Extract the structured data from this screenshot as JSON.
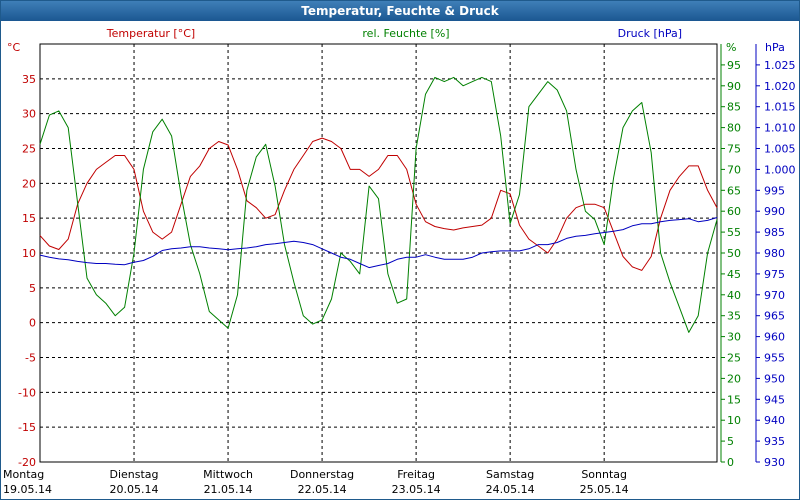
{
  "window": {
    "title": "Temperatur, Feuchte & Druck"
  },
  "colors": {
    "temperature": "#c00000",
    "humidity": "#008000",
    "pressure": "#0000c0",
    "titlebar": "#2a6aa6"
  },
  "chart_data": {
    "type": "line",
    "title": "Temperatur, Feuchte & Druck",
    "grid": true,
    "axes": {
      "temperature": {
        "unit": "°C",
        "label": "Temperatur [°C]",
        "range": [
          -20,
          40
        ],
        "ticks": [
          -20,
          -15,
          -10,
          -5,
          0,
          5,
          10,
          15,
          20,
          25,
          30,
          35
        ]
      },
      "humidity": {
        "unit": "%",
        "label": "rel. Feuchte [%]",
        "range": [
          0,
          100
        ],
        "ticks": [
          0,
          5,
          10,
          15,
          20,
          25,
          30,
          35,
          40,
          45,
          50,
          55,
          60,
          65,
          70,
          75,
          80,
          85,
          90,
          95
        ]
      },
      "pressure": {
        "unit": "hPa",
        "label": "Druck [hPa]",
        "range": [
          930,
          1030
        ],
        "ticks": [
          "930",
          "935",
          "940",
          "945",
          "950",
          "955",
          "960",
          "965",
          "970",
          "975",
          "980",
          "985",
          "990",
          "995",
          "1.000",
          "1.005",
          "1.010",
          "1.015",
          "1.020",
          "1.025"
        ]
      }
    },
    "x_ticks": [
      {
        "day": "Montag",
        "date": "19.05.14"
      },
      {
        "day": "Dienstag",
        "date": "20.05.14"
      },
      {
        "day": "Mittwoch",
        "date": "21.05.14"
      },
      {
        "day": "Donnerstag",
        "date": "22.05.14"
      },
      {
        "day": "Freitag",
        "date": "23.05.14"
      },
      {
        "day": "Samstag",
        "date": "24.05.14"
      },
      {
        "day": "Sonntag",
        "date": "25.05.14"
      }
    ],
    "x_unit": "days since 19.05.14 00:00",
    "x_range": [
      0,
      7.2
    ],
    "series": [
      {
        "name": "Temperatur [°C]",
        "axis": "temperature",
        "color": "#c00000",
        "points": [
          [
            0.0,
            12.5
          ],
          [
            0.1,
            11.0
          ],
          [
            0.2,
            10.5
          ],
          [
            0.3,
            12.0
          ],
          [
            0.4,
            17.0
          ],
          [
            0.5,
            20.0
          ],
          [
            0.6,
            22.0
          ],
          [
            0.7,
            23.0
          ],
          [
            0.8,
            24.0
          ],
          [
            0.9,
            24.0
          ],
          [
            1.0,
            22.0
          ],
          [
            1.1,
            16.0
          ],
          [
            1.2,
            13.0
          ],
          [
            1.3,
            12.0
          ],
          [
            1.4,
            13.0
          ],
          [
            1.5,
            17.0
          ],
          [
            1.6,
            21.0
          ],
          [
            1.7,
            22.5
          ],
          [
            1.8,
            25.0
          ],
          [
            1.9,
            26.0
          ],
          [
            2.0,
            25.5
          ],
          [
            2.1,
            22.0
          ],
          [
            2.2,
            17.5
          ],
          [
            2.3,
            16.5
          ],
          [
            2.4,
            15.0
          ],
          [
            2.5,
            15.5
          ],
          [
            2.6,
            19.0
          ],
          [
            2.7,
            22.0
          ],
          [
            2.8,
            24.0
          ],
          [
            2.9,
            26.0
          ],
          [
            3.0,
            26.5
          ],
          [
            3.1,
            26.0
          ],
          [
            3.2,
            25.0
          ],
          [
            3.3,
            22.0
          ],
          [
            3.4,
            22.0
          ],
          [
            3.5,
            21.0
          ],
          [
            3.6,
            22.0
          ],
          [
            3.7,
            24.0
          ],
          [
            3.8,
            24.0
          ],
          [
            3.9,
            22.0
          ],
          [
            4.0,
            17.0
          ],
          [
            4.1,
            14.5
          ],
          [
            4.2,
            13.8
          ],
          [
            4.3,
            13.5
          ],
          [
            4.4,
            13.3
          ],
          [
            4.5,
            13.6
          ],
          [
            4.6,
            13.8
          ],
          [
            4.7,
            14.0
          ],
          [
            4.8,
            15.0
          ],
          [
            4.9,
            19.0
          ],
          [
            5.0,
            18.5
          ],
          [
            5.1,
            14.0
          ],
          [
            5.2,
            12.0
          ],
          [
            5.3,
            11.0
          ],
          [
            5.4,
            10.0
          ],
          [
            5.5,
            12.0
          ],
          [
            5.6,
            15.0
          ],
          [
            5.7,
            16.5
          ],
          [
            5.8,
            17.0
          ],
          [
            5.9,
            17.0
          ],
          [
            6.0,
            16.5
          ],
          [
            6.1,
            13.0
          ],
          [
            6.2,
            9.5
          ],
          [
            6.3,
            8.0
          ],
          [
            6.4,
            7.5
          ],
          [
            6.5,
            9.5
          ],
          [
            6.6,
            15.0
          ],
          [
            6.7,
            19.0
          ],
          [
            6.8,
            21.0
          ],
          [
            6.9,
            22.5
          ],
          [
            7.0,
            22.5
          ],
          [
            7.1,
            19.0
          ],
          [
            7.2,
            16.5
          ]
        ]
      },
      {
        "name": "rel. Feuchte [%]",
        "axis": "humidity",
        "color": "#008000",
        "points": [
          [
            0.0,
            76
          ],
          [
            0.1,
            83
          ],
          [
            0.2,
            84
          ],
          [
            0.3,
            80
          ],
          [
            0.4,
            62
          ],
          [
            0.5,
            44
          ],
          [
            0.6,
            40
          ],
          [
            0.7,
            38
          ],
          [
            0.8,
            35
          ],
          [
            0.9,
            37
          ],
          [
            1.0,
            50
          ],
          [
            1.1,
            70
          ],
          [
            1.2,
            79
          ],
          [
            1.3,
            82
          ],
          [
            1.4,
            78
          ],
          [
            1.5,
            64
          ],
          [
            1.6,
            52
          ],
          [
            1.7,
            45
          ],
          [
            1.8,
            36
          ],
          [
            1.9,
            34
          ],
          [
            2.0,
            32
          ],
          [
            2.1,
            40
          ],
          [
            2.2,
            65
          ],
          [
            2.3,
            73
          ],
          [
            2.4,
            76
          ],
          [
            2.5,
            66
          ],
          [
            2.6,
            52
          ],
          [
            2.7,
            43
          ],
          [
            2.8,
            35
          ],
          [
            2.9,
            33
          ],
          [
            3.0,
            34
          ],
          [
            3.1,
            39
          ],
          [
            3.2,
            50
          ],
          [
            3.3,
            48
          ],
          [
            3.4,
            45
          ],
          [
            3.5,
            66
          ],
          [
            3.6,
            63
          ],
          [
            3.7,
            45
          ],
          [
            3.8,
            38
          ],
          [
            3.9,
            39
          ],
          [
            4.0,
            75
          ],
          [
            4.1,
            88
          ],
          [
            4.2,
            92
          ],
          [
            4.3,
            91
          ],
          [
            4.4,
            92
          ],
          [
            4.5,
            90
          ],
          [
            4.6,
            91
          ],
          [
            4.7,
            92
          ],
          [
            4.8,
            91
          ],
          [
            4.9,
            78
          ],
          [
            5.0,
            57
          ],
          [
            5.1,
            64
          ],
          [
            5.2,
            85
          ],
          [
            5.3,
            88
          ],
          [
            5.4,
            91
          ],
          [
            5.5,
            89
          ],
          [
            5.6,
            84
          ],
          [
            5.7,
            70
          ],
          [
            5.8,
            60
          ],
          [
            5.9,
            58
          ],
          [
            6.0,
            52
          ],
          [
            6.1,
            68
          ],
          [
            6.2,
            80
          ],
          [
            6.3,
            84
          ],
          [
            6.4,
            86
          ],
          [
            6.5,
            74
          ],
          [
            6.6,
            50
          ],
          [
            6.7,
            43
          ],
          [
            6.8,
            37
          ],
          [
            6.9,
            31
          ],
          [
            7.0,
            35
          ],
          [
            7.1,
            50
          ],
          [
            7.2,
            58
          ]
        ]
      },
      {
        "name": "Druck [hPa]",
        "axis": "pressure",
        "color": "#0000c0",
        "points": [
          [
            0.0,
            979.5
          ],
          [
            0.1,
            979.0
          ],
          [
            0.2,
            978.6
          ],
          [
            0.3,
            978.4
          ],
          [
            0.4,
            978.0
          ],
          [
            0.5,
            977.7
          ],
          [
            0.6,
            977.5
          ],
          [
            0.7,
            977.5
          ],
          [
            0.8,
            977.3
          ],
          [
            0.9,
            977.2
          ],
          [
            1.0,
            977.8
          ],
          [
            1.1,
            978.2
          ],
          [
            1.2,
            979.2
          ],
          [
            1.3,
            980.6
          ],
          [
            1.4,
            981.0
          ],
          [
            1.5,
            981.2
          ],
          [
            1.6,
            981.5
          ],
          [
            1.7,
            981.5
          ],
          [
            1.8,
            981.2
          ],
          [
            1.9,
            981.0
          ],
          [
            2.0,
            980.8
          ],
          [
            2.1,
            981.0
          ],
          [
            2.2,
            981.2
          ],
          [
            2.3,
            981.5
          ],
          [
            2.4,
            982.0
          ],
          [
            2.5,
            982.2
          ],
          [
            2.6,
            982.5
          ],
          [
            2.7,
            982.8
          ],
          [
            2.8,
            982.5
          ],
          [
            2.9,
            982.0
          ],
          [
            3.0,
            981.0
          ],
          [
            3.1,
            980.0
          ],
          [
            3.2,
            979.0
          ],
          [
            3.3,
            978.5
          ],
          [
            3.4,
            977.5
          ],
          [
            3.5,
            976.5
          ],
          [
            3.6,
            977.0
          ],
          [
            3.7,
            977.5
          ],
          [
            3.8,
            978.5
          ],
          [
            3.9,
            979.0
          ],
          [
            4.0,
            979.0
          ],
          [
            4.1,
            979.6
          ],
          [
            4.2,
            979.0
          ],
          [
            4.3,
            978.5
          ],
          [
            4.4,
            978.5
          ],
          [
            4.5,
            978.5
          ],
          [
            4.6,
            979.0
          ],
          [
            4.7,
            980.0
          ],
          [
            4.8,
            980.3
          ],
          [
            4.9,
            980.5
          ],
          [
            5.0,
            980.5
          ],
          [
            5.1,
            980.5
          ],
          [
            5.2,
            981.0
          ],
          [
            5.3,
            982.0
          ],
          [
            5.4,
            982.0
          ],
          [
            5.5,
            982.5
          ],
          [
            5.6,
            983.5
          ],
          [
            5.7,
            984.0
          ],
          [
            5.8,
            984.2
          ],
          [
            5.9,
            984.6
          ],
          [
            6.0,
            984.9
          ],
          [
            6.1,
            985.2
          ],
          [
            6.2,
            985.6
          ],
          [
            6.3,
            986.5
          ],
          [
            6.4,
            987.0
          ],
          [
            6.5,
            987.0
          ],
          [
            6.6,
            987.5
          ],
          [
            6.7,
            987.8
          ],
          [
            6.8,
            988.0
          ],
          [
            6.9,
            988.2
          ],
          [
            7.0,
            987.5
          ],
          [
            7.1,
            987.8
          ],
          [
            7.2,
            988.5
          ]
        ]
      }
    ]
  }
}
